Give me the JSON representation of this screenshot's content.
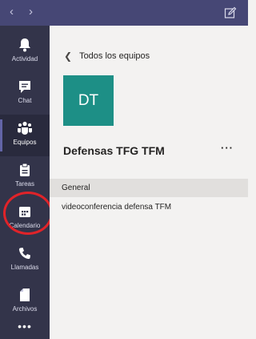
{
  "topbar": {
    "back_icon": "chevron-left-icon",
    "forward_icon": "chevron-right-icon",
    "compose_icon": "compose-icon",
    "colors": {
      "background": "#464775"
    }
  },
  "rail": {
    "colors": {
      "background": "#33344a",
      "active": "#292a3d",
      "accent": "#6264a7"
    },
    "items": [
      {
        "label": "Actividad",
        "icon": "bell-icon",
        "active": false
      },
      {
        "label": "Chat",
        "icon": "chat-icon",
        "active": false
      },
      {
        "label": "Equipos",
        "icon": "teams-icon",
        "active": true
      },
      {
        "label": "Tareas",
        "icon": "tasks-icon",
        "active": false
      },
      {
        "label": "Calendario",
        "icon": "calendar-icon",
        "active": false
      },
      {
        "label": "Llamadas",
        "icon": "phone-icon",
        "active": false
      },
      {
        "label": "Archivos",
        "icon": "files-icon",
        "active": false
      }
    ],
    "more_label": "•••",
    "highlight": {
      "target": "Calendario",
      "color": "#e02329"
    }
  },
  "panel": {
    "back_label": "Todos los equipos",
    "team": {
      "initials": "DT",
      "avatar_color": "#1d8f86",
      "name": "Defensas TFG TFM",
      "more_label": "···"
    },
    "channels": [
      {
        "label": "General",
        "selected": true
      },
      {
        "label": "videoconferencia defensa TFM",
        "selected": false
      }
    ]
  }
}
